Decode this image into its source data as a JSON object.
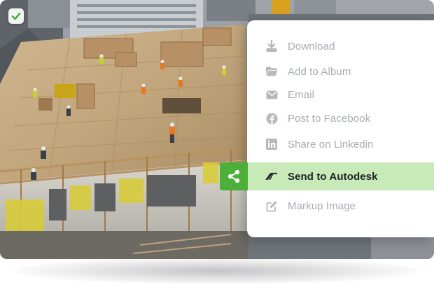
{
  "menu": {
    "items": [
      {
        "label": "Download",
        "icon": "download-icon"
      },
      {
        "label": "Add to Album",
        "icon": "folder-icon"
      },
      {
        "label": "Email",
        "icon": "envelope-icon"
      },
      {
        "label": "Post to Facebook",
        "icon": "facebook-icon"
      },
      {
        "label": "Share on Linkedin",
        "icon": "linkedin-icon"
      },
      {
        "label": "Send to Autodesk",
        "icon": "autodesk-icon",
        "active": true
      },
      {
        "label": "Markup Image",
        "icon": "edit-icon"
      }
    ]
  },
  "share_button": {
    "icon": "share-icon"
  },
  "selection": {
    "icon": "checkmark-icon",
    "checked": true
  },
  "colors": {
    "accent": "#4caf3a",
    "active_row": "#c8eab8",
    "muted_text": "#a8acb2",
    "active_text": "#1f2326"
  }
}
